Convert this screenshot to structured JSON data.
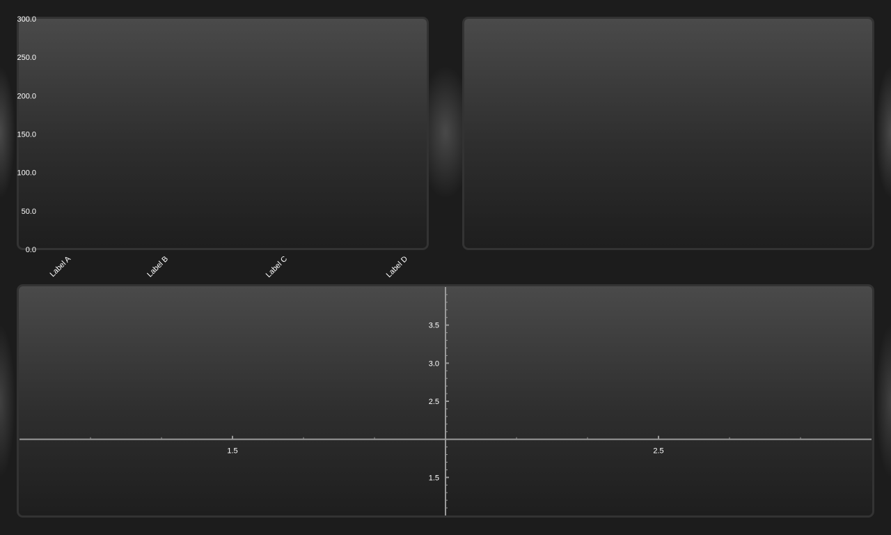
{
  "chart_data": [
    {
      "type": "bar",
      "categories": [
        "Label A",
        "Label B",
        "Label C",
        "Label D"
      ],
      "ytick_labels": [
        "0.0",
        "50.0",
        "100.0",
        "150.0",
        "200.0",
        "250.0",
        "300.0"
      ],
      "ylim": [
        0,
        300
      ],
      "values": [],
      "title": "",
      "xlabel": "",
      "ylabel": "",
      "grid": false
    },
    {
      "type": "line",
      "title": "",
      "series": []
    },
    {
      "type": "line",
      "xtick_labels": [
        "1.5",
        "2.5"
      ],
      "ytick_labels": [
        "1.5",
        "2.5",
        "3.0",
        "3.5"
      ],
      "xlim": [
        1.0,
        3.0
      ],
      "ylim": [
        1.0,
        4.0
      ],
      "axis_origin": {
        "x": 2.0,
        "y": 2.0
      },
      "series": [],
      "title": "",
      "grid": false
    }
  ],
  "colors": {
    "background": "#1c1c1c",
    "panel_top": "#4a4a4a",
    "panel_bottom": "#1e1e1e",
    "panel_border": "#333333",
    "axis": "#9a9a9a",
    "text": "#ffffff"
  }
}
